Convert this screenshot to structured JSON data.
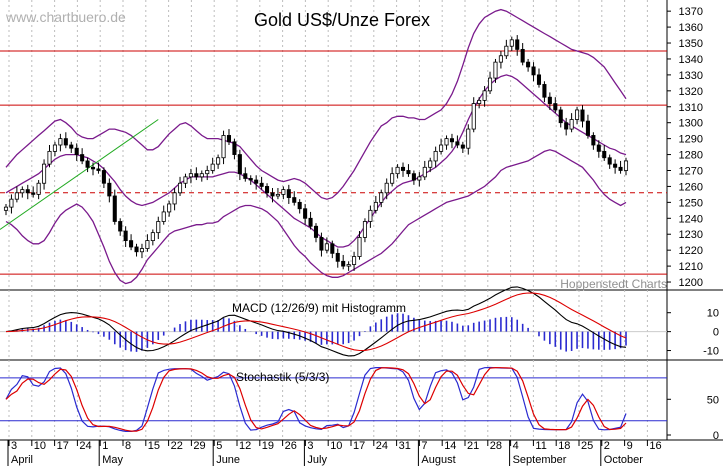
{
  "watermark": "www.chartbuero.de",
  "credit": "Hoppenstedt Charts",
  "chart_data": [
    {
      "type": "candlestick",
      "title": "Gold US$/Unze Forex",
      "ylim": [
        1195,
        1377
      ],
      "yticks": [
        1200,
        1210,
        1220,
        1230,
        1240,
        1250,
        1260,
        1270,
        1280,
        1290,
        1300,
        1310,
        1320,
        1330,
        1340,
        1350,
        1360,
        1370
      ],
      "horizontal_lines": [
        {
          "value": 1345,
          "style": "solid",
          "color": "#cc0000"
        },
        {
          "value": 1311,
          "style": "solid",
          "color": "#cc0000"
        },
        {
          "value": 1256,
          "style": "dashed",
          "color": "#cc0000"
        },
        {
          "value": 1205,
          "style": "solid",
          "color": "#cc0000"
        }
      ],
      "close": [
        1247,
        1252,
        1256,
        1258,
        1256,
        1255,
        1262,
        1274,
        1282,
        1286,
        1290,
        1286,
        1284,
        1280,
        1276,
        1272,
        1271,
        1270,
        1262,
        1254,
        1238,
        1232,
        1226,
        1222,
        1219,
        1221,
        1226,
        1231,
        1238,
        1244,
        1249,
        1256,
        1262,
        1266,
        1268,
        1266,
        1268,
        1270,
        1274,
        1278,
        1292,
        1288,
        1280,
        1268,
        1265,
        1264,
        1262,
        1260,
        1256,
        1254,
        1255,
        1258,
        1253,
        1250,
        1246,
        1240,
        1235,
        1228,
        1220,
        1224,
        1218,
        1213,
        1210,
        1211,
        1216,
        1228,
        1238,
        1245,
        1250,
        1256,
        1262,
        1268,
        1272,
        1270,
        1268,
        1264,
        1266,
        1272,
        1276,
        1282,
        1286,
        1290,
        1288,
        1286,
        1284,
        1296,
        1312,
        1314,
        1320,
        1328,
        1338,
        1342,
        1348,
        1352,
        1346,
        1338,
        1335,
        1330,
        1324,
        1316,
        1312,
        1308,
        1300,
        1296,
        1302,
        1308,
        1301,
        1292,
        1286,
        1282,
        1278,
        1274,
        1272,
        1270,
        1276
      ],
      "bollinger_upper": [
        1272,
        1276,
        1280,
        1283,
        1286,
        1289,
        1292,
        1295,
        1298,
        1301,
        1302,
        1300,
        1297,
        1293,
        1291,
        1290,
        1290,
        1292,
        1294,
        1296,
        1296,
        1295,
        1294,
        1292,
        1289,
        1286,
        1283,
        1283,
        1285,
        1289,
        1293,
        1296,
        1299,
        1300,
        1298,
        1295,
        1292,
        1290,
        1290,
        1290,
        1289,
        1288,
        1287,
        1285,
        1281,
        1277,
        1273,
        1270,
        1268,
        1266,
        1264,
        1263,
        1264,
        1265,
        1264,
        1262,
        1259,
        1256,
        1253,
        1252,
        1253,
        1256,
        1260,
        1265,
        1270,
        1276,
        1282,
        1288,
        1293,
        1298,
        1300,
        1303,
        1304,
        1304,
        1303,
        1303,
        1302,
        1302,
        1304,
        1306,
        1308,
        1312,
        1318,
        1326,
        1336,
        1347,
        1356,
        1362,
        1366,
        1368,
        1370,
        1371,
        1370,
        1368,
        1366,
        1364,
        1362,
        1360,
        1358,
        1356,
        1354,
        1352,
        1350,
        1348,
        1346,
        1345,
        1344,
        1343,
        1341,
        1338,
        1335,
        1330,
        1325,
        1320,
        1315
      ],
      "bollinger_mid": [
        1256,
        1258,
        1260,
        1262,
        1264,
        1266,
        1268,
        1271,
        1274,
        1277,
        1279,
        1280,
        1280,
        1280,
        1279,
        1278,
        1276,
        1274,
        1271,
        1267,
        1263,
        1258,
        1254,
        1251,
        1249,
        1248,
        1249,
        1250,
        1252,
        1254,
        1256,
        1259,
        1262,
        1264,
        1266,
        1266,
        1266,
        1266,
        1266,
        1267,
        1268,
        1269,
        1269,
        1268,
        1266,
        1264,
        1261,
        1258,
        1255,
        1252,
        1249,
        1246,
        1243,
        1240,
        1238,
        1236,
        1234,
        1231,
        1228,
        1226,
        1224,
        1222,
        1222,
        1223,
        1226,
        1230,
        1235,
        1240,
        1245,
        1250,
        1254,
        1257,
        1260,
        1262,
        1263,
        1264,
        1266,
        1268,
        1270,
        1272,
        1275,
        1278,
        1282,
        1287,
        1294,
        1302,
        1309,
        1315,
        1320,
        1324,
        1327,
        1329,
        1330,
        1329,
        1327,
        1324,
        1321,
        1318,
        1315,
        1312,
        1309,
        1306,
        1303,
        1300,
        1298,
        1296,
        1294,
        1292,
        1290,
        1288,
        1286,
        1284,
        1283,
        1281,
        1280
      ],
      "bollinger_lower": [
        1238,
        1236,
        1233,
        1229,
        1226,
        1224,
        1224,
        1226,
        1231,
        1237,
        1242,
        1245,
        1247,
        1249,
        1247,
        1243,
        1238,
        1230,
        1222,
        1213,
        1206,
        1201,
        1199,
        1200,
        1203,
        1208,
        1214,
        1218,
        1222,
        1226,
        1230,
        1232,
        1233,
        1234,
        1235,
        1236,
        1236,
        1237,
        1237,
        1238,
        1241,
        1243,
        1245,
        1247,
        1248,
        1248,
        1247,
        1246,
        1244,
        1241,
        1238,
        1233,
        1228,
        1223,
        1219,
        1216,
        1212,
        1209,
        1206,
        1204,
        1203,
        1203,
        1204,
        1206,
        1208,
        1210,
        1212,
        1214,
        1216,
        1218,
        1221,
        1224,
        1228,
        1232,
        1236,
        1238,
        1240,
        1242,
        1244,
        1246,
        1248,
        1250,
        1251,
        1252,
        1253,
        1254,
        1256,
        1258,
        1260,
        1263,
        1266,
        1270,
        1272,
        1273,
        1274,
        1275,
        1276,
        1278,
        1280,
        1282,
        1283,
        1282,
        1280,
        1278,
        1276,
        1274,
        1272,
        1268,
        1264,
        1259,
        1255,
        1252,
        1250,
        1248,
        1250
      ],
      "trendline": {
        "from": [
          0,
          1233
        ],
        "to": [
          28,
          1302
        ]
      }
    },
    {
      "type": "line",
      "title": "MACD (12/26/9) mit Histogramm",
      "ylim": [
        -15,
        22
      ],
      "yticks": [
        -10,
        0,
        10
      ],
      "series": []
    },
    {
      "type": "line",
      "title": "Stochastik (5/3/3)",
      "ylim": [
        -7,
        105
      ],
      "yticks": [
        0,
        50
      ],
      "reference_lines": [
        20,
        80
      ],
      "series": []
    }
  ],
  "x_axis": {
    "day_labels": [
      "3",
      "10",
      "17",
      "24",
      "1",
      "8",
      "15",
      "22",
      "29",
      "5",
      "12",
      "19",
      "26",
      "3",
      "10",
      "17",
      "24",
      "31",
      "7",
      "14",
      "21",
      "28",
      "4",
      "11",
      "18",
      "25",
      "2",
      "9",
      "16"
    ],
    "month_labels": [
      "April",
      "May",
      "June",
      "July",
      "August",
      "September",
      "October"
    ]
  }
}
